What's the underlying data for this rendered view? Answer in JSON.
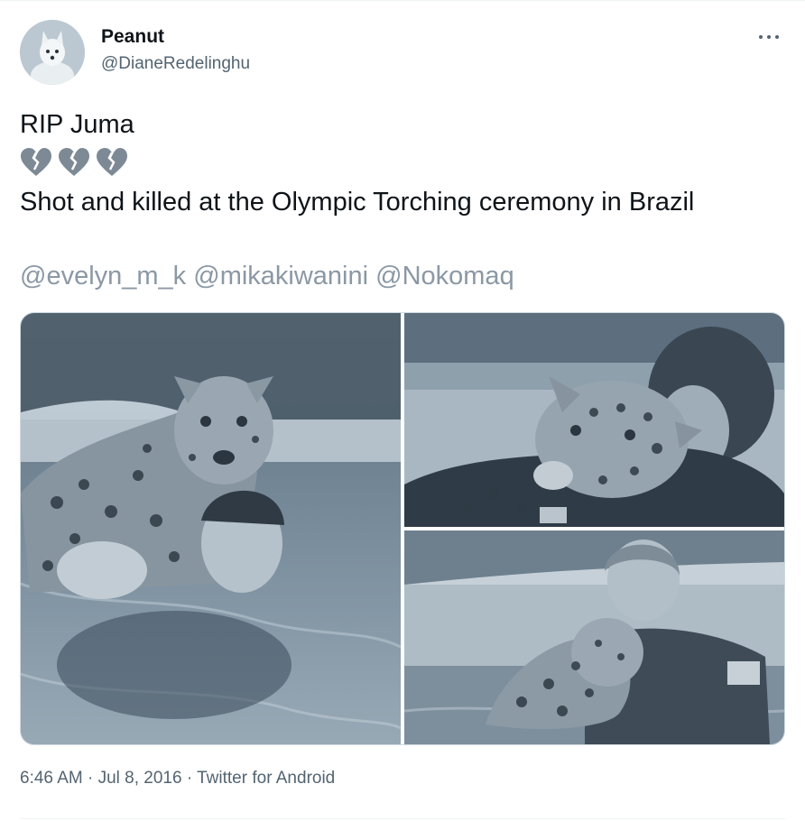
{
  "tweet": {
    "author_name": "Peanut",
    "author_handle": "@DianeRedelinghu",
    "line1": "RIP Juma",
    "emoji": [
      "broken-heart-icon",
      "broken-heart-icon",
      "broken-heart-icon"
    ],
    "line2": "Shot and killed at the Olympic Torching ceremony in Brazil",
    "mentions": [
      "@evelyn_m_k",
      "@mikakiwanini",
      "@Nokomaq"
    ],
    "time": "6:46 AM",
    "date": "Jul 8, 2016",
    "source": "Twitter for Android",
    "separator": "·"
  },
  "colors": {
    "text": "#0f1419",
    "secondary": "#536471",
    "mention": "#8b98a5",
    "border": "#cfd9de",
    "photo_tint": "#4a5d6e"
  }
}
